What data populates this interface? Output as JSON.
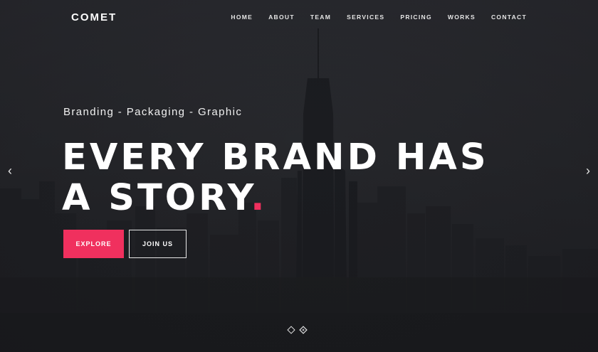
{
  "brand": {
    "logo": "COMET"
  },
  "nav": {
    "items": [
      "HOME",
      "ABOUT",
      "TEAM",
      "SERVICES",
      "PRICING",
      "WORKS",
      "CONTACT"
    ]
  },
  "hero": {
    "subtitle": "Branding - Packaging - Graphic",
    "headline_line1": "EVERY BRAND HAS",
    "headline_line2": "A STORY",
    "headline_dot": ".",
    "explore_label": "EXPLORE",
    "join_label": "JOIN US",
    "accent_color": "#f0305e",
    "prev_arrow": "‹",
    "next_arrow": "›",
    "slides": {
      "count": 2,
      "active": 2
    }
  }
}
